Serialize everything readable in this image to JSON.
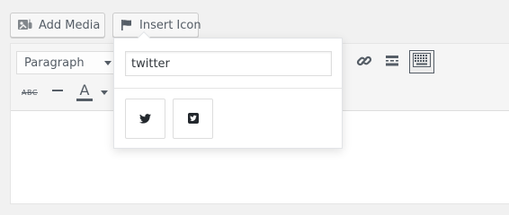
{
  "media_buttons": {
    "add_media_label": "Add Media",
    "insert_icon_label": "Insert Icon"
  },
  "toolbar": {
    "format_select_value": "Paragraph",
    "strikethrough_label": "ABC",
    "text_color_label": "A",
    "icons": [
      "link-icon",
      "read-more-icon",
      "toolbar-toggle-icon",
      "strikethrough-icon",
      "horizontal-line-icon",
      "text-color-icon",
      "chevron-down-icon"
    ]
  },
  "icon_picker": {
    "search_value": "twitter",
    "results": [
      {
        "icon": "twitter-bird-icon"
      },
      {
        "icon": "twitter-square-icon"
      }
    ]
  },
  "colors": {
    "accent": "#555d66",
    "active_border": "#555d66",
    "background": "#f1f1f1"
  }
}
